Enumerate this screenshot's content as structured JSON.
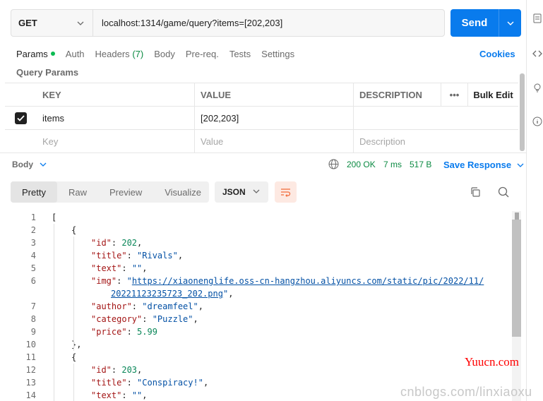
{
  "request": {
    "method": "GET",
    "url": "localhost:1314/game/query?items=[202,203]",
    "send_label": "Send"
  },
  "tabs": [
    {
      "label": "Params",
      "active": true,
      "dot": true
    },
    {
      "label": "Auth"
    },
    {
      "label": "Headers",
      "count": "(7)"
    },
    {
      "label": "Body"
    },
    {
      "label": "Pre-req."
    },
    {
      "label": "Tests"
    },
    {
      "label": "Settings"
    }
  ],
  "cookies_label": "Cookies",
  "query_params_title": "Query Params",
  "params_table": {
    "headers": {
      "key": "KEY",
      "value": "VALUE",
      "description": "DESCRIPTION",
      "more": "•••",
      "bulk_edit": "Bulk Edit"
    },
    "rows": [
      {
        "checked": true,
        "key": "items",
        "value": "[202,203]",
        "description": ""
      }
    ],
    "placeholders": {
      "key": "Key",
      "value": "Value",
      "description": "Description"
    }
  },
  "response": {
    "body_label": "Body",
    "status": "200 OK",
    "time": "7 ms",
    "size": "517 B",
    "save_label": "Save Response",
    "views": [
      "Pretty",
      "Raw",
      "Preview",
      "Visualize"
    ],
    "active_view": "Pretty",
    "format": "JSON"
  },
  "code_lines": [
    {
      "n": "1",
      "indent": 0,
      "parts": [
        {
          "t": "p",
          "v": "["
        }
      ]
    },
    {
      "n": "2",
      "indent": 1,
      "parts": [
        {
          "t": "p",
          "v": "{"
        }
      ]
    },
    {
      "n": "3",
      "indent": 2,
      "parts": [
        {
          "t": "k",
          "v": "\"id\""
        },
        {
          "t": "p",
          "v": ": "
        },
        {
          "t": "n",
          "v": "202"
        },
        {
          "t": "p",
          "v": ","
        }
      ]
    },
    {
      "n": "4",
      "indent": 2,
      "parts": [
        {
          "t": "k",
          "v": "\"title\""
        },
        {
          "t": "p",
          "v": ": "
        },
        {
          "t": "s",
          "v": "\"Rivals\""
        },
        {
          "t": "p",
          "v": ","
        }
      ]
    },
    {
      "n": "5",
      "indent": 2,
      "parts": [
        {
          "t": "k",
          "v": "\"text\""
        },
        {
          "t": "p",
          "v": ": "
        },
        {
          "t": "s",
          "v": "\"\""
        },
        {
          "t": "p",
          "v": ","
        }
      ]
    },
    {
      "n": "6",
      "indent": 2,
      "parts": [
        {
          "t": "k",
          "v": "\"img\""
        },
        {
          "t": "p",
          "v": ": "
        },
        {
          "t": "s",
          "v": "\""
        },
        {
          "t": "link",
          "v": "https://xiaonenglife.oss-cn-hangzhou.aliyuncs.com/static/pic/2022/11/"
        }
      ]
    },
    {
      "n": "",
      "indent": 3,
      "parts": [
        {
          "t": "link",
          "v": "20221123235723_202.png"
        },
        {
          "t": "s",
          "v": "\""
        },
        {
          "t": "p",
          "v": ","
        }
      ]
    },
    {
      "n": "7",
      "indent": 2,
      "parts": [
        {
          "t": "k",
          "v": "\"author\""
        },
        {
          "t": "p",
          "v": ": "
        },
        {
          "t": "s",
          "v": "\"dreamfeel\""
        },
        {
          "t": "p",
          "v": ","
        }
      ]
    },
    {
      "n": "8",
      "indent": 2,
      "parts": [
        {
          "t": "k",
          "v": "\"category\""
        },
        {
          "t": "p",
          "v": ": "
        },
        {
          "t": "s",
          "v": "\"Puzzle\""
        },
        {
          "t": "p",
          "v": ","
        }
      ]
    },
    {
      "n": "9",
      "indent": 2,
      "parts": [
        {
          "t": "k",
          "v": "\"price\""
        },
        {
          "t": "p",
          "v": ": "
        },
        {
          "t": "n",
          "v": "5.99"
        }
      ]
    },
    {
      "n": "10",
      "indent": 1,
      "parts": [
        {
          "t": "p",
          "v": "},"
        }
      ]
    },
    {
      "n": "11",
      "indent": 1,
      "parts": [
        {
          "t": "p",
          "v": "{"
        }
      ]
    },
    {
      "n": "12",
      "indent": 2,
      "parts": [
        {
          "t": "k",
          "v": "\"id\""
        },
        {
          "t": "p",
          "v": ": "
        },
        {
          "t": "n",
          "v": "203"
        },
        {
          "t": "p",
          "v": ","
        }
      ]
    },
    {
      "n": "13",
      "indent": 2,
      "parts": [
        {
          "t": "k",
          "v": "\"title\""
        },
        {
          "t": "p",
          "v": ": "
        },
        {
          "t": "s",
          "v": "\"Conspiracy!\""
        },
        {
          "t": "p",
          "v": ","
        }
      ]
    },
    {
      "n": "14",
      "indent": 2,
      "parts": [
        {
          "t": "k",
          "v": "\"text\""
        },
        {
          "t": "p",
          "v": ": "
        },
        {
          "t": "s",
          "v": "\"\""
        },
        {
          "t": "p",
          "v": ","
        }
      ]
    }
  ],
  "watermarks": {
    "site": "Yuucn.com",
    "blog": "cnblogs.com/linxiaoxu"
  }
}
